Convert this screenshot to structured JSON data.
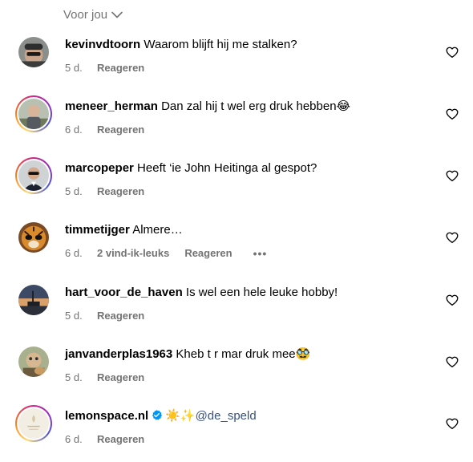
{
  "sort": {
    "label": "Voor jou"
  },
  "comments": [
    {
      "username": "kevinvdtoorn",
      "text": "Waarom blijft hij me stalken?",
      "time": "5 d.",
      "likes": "",
      "reply": "Reageren",
      "more": false,
      "ring": false,
      "verified": false,
      "mention": "",
      "avatar": "man-cap-sunglasses"
    },
    {
      "username": "meneer_herman",
      "text": "Dan zal hij t wel erg druk hebben😂",
      "time": "6 d.",
      "likes": "",
      "reply": "Reageren",
      "more": false,
      "ring": true,
      "verified": false,
      "mention": "",
      "avatar": "bald-man-outdoors"
    },
    {
      "username": "marcopeper",
      "text": "Heeft ‘ie John Heitinga al gespot?",
      "time": "5 d.",
      "likes": "",
      "reply": "Reageren",
      "more": false,
      "ring": true,
      "verified": false,
      "mention": "",
      "avatar": "man-sunglasses-suit"
    },
    {
      "username": "timmetijger",
      "text": "Almere…",
      "time": "6 d.",
      "likes": "2 vind-ik-leuks",
      "reply": "Reageren",
      "more": true,
      "ring": false,
      "verified": false,
      "mention": "",
      "avatar": "tiger-sunglasses"
    },
    {
      "username": "hart_voor_de_haven",
      "text": "Is wel een hele leuke hobby!",
      "time": "5 d.",
      "likes": "",
      "reply": "Reageren",
      "more": false,
      "ring": false,
      "verified": false,
      "mention": "",
      "avatar": "harbor-sunset"
    },
    {
      "username": "janvanderplas1963",
      "text": "Kheb t r mar druk mee🥸",
      "time": "5 d.",
      "likes": "",
      "reply": "Reageren",
      "more": false,
      "ring": false,
      "verified": false,
      "mention": "",
      "avatar": "man-with-dog"
    },
    {
      "username": "lemonspace.nl",
      "text": "☀️✨",
      "time": "6 d.",
      "likes": "",
      "reply": "Reageren",
      "more": false,
      "ring": true,
      "verified": true,
      "mention": "@de_speld",
      "avatar": "lemonspace-logo"
    }
  ]
}
